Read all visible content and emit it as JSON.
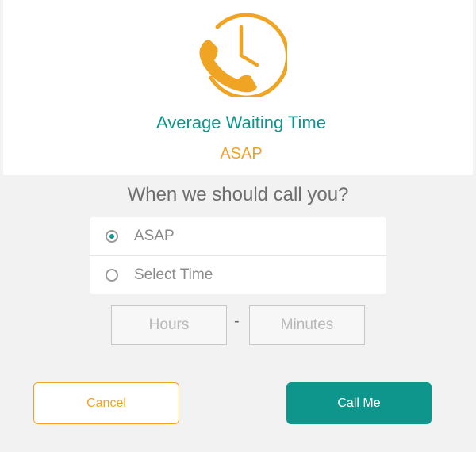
{
  "header": {
    "icon": "clock-phone-icon",
    "title": "Average Waiting Time",
    "wait_value": "ASAP"
  },
  "question": "When we should call you?",
  "options": [
    {
      "label": "ASAP",
      "selected": true
    },
    {
      "label": "Select Time",
      "selected": false
    }
  ],
  "time": {
    "hours_placeholder": "Hours",
    "separator": "-",
    "minutes_placeholder": "Minutes"
  },
  "actions": {
    "cancel_label": "Cancel",
    "call_label": "Call Me"
  },
  "colors": {
    "accent": "#f0a424",
    "primary": "#0f968c",
    "background": "#f2f2f2"
  }
}
